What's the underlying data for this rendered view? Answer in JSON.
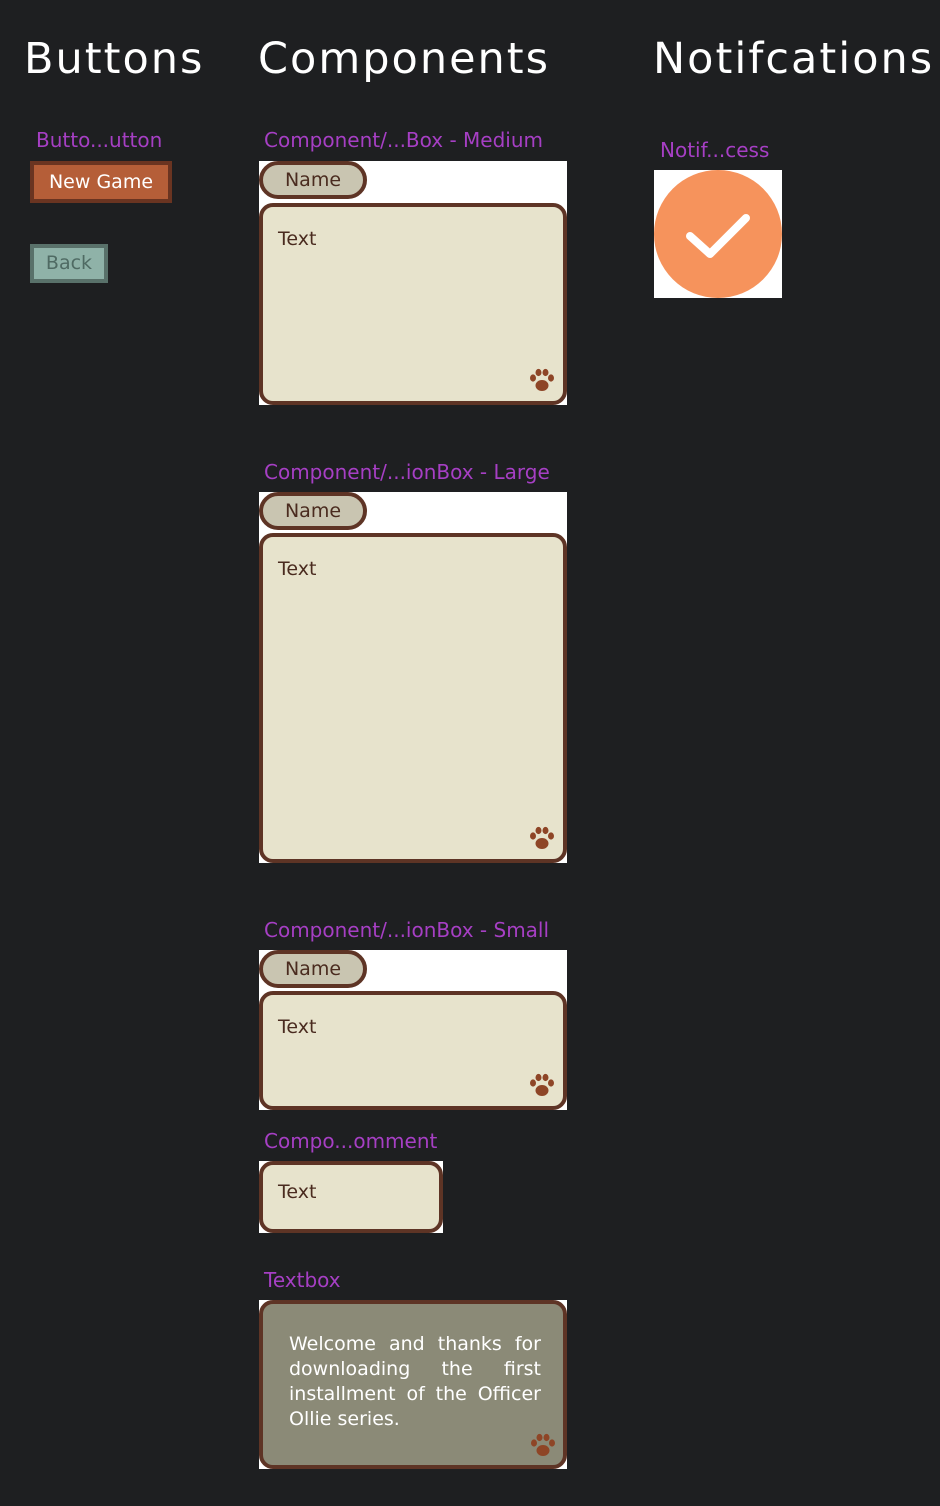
{
  "sections": {
    "buttons": "Buttons",
    "components": "Components",
    "notifications": "Notifcations"
  },
  "buttons_frame": {
    "label": "Butto...utton",
    "new_game": "New Game",
    "back": "Back"
  },
  "dialog_medium": {
    "label": "Component/...Box - Medium",
    "name": "Name",
    "text": "Text"
  },
  "dialog_large": {
    "label": "Component/...ionBox - Large",
    "name": "Name",
    "text": "Text"
  },
  "dialog_small": {
    "label": "Component/...ionBox - Small",
    "name": "Name",
    "text": "Text"
  },
  "comment": {
    "label": "Compo...omment",
    "text": "Text"
  },
  "textbox": {
    "label": "Textbox",
    "text": "Welcome and thanks for downloading the first installment of the Officer Ollie series."
  },
  "notification": {
    "label": "Notif...cess",
    "icon": "checkmark-icon",
    "color": "#f6935c"
  },
  "colors": {
    "background": "#1e1f21",
    "frame_label": "#a63fc4",
    "primary_button": "#b55e38",
    "secondary_button": "#8fb2a8",
    "box_fill": "#e7e3cc",
    "box_border": "#5e3425",
    "name_pill": "#c9c5b1",
    "textbox_fill": "#8b8a77",
    "paw": "#8e4526"
  }
}
